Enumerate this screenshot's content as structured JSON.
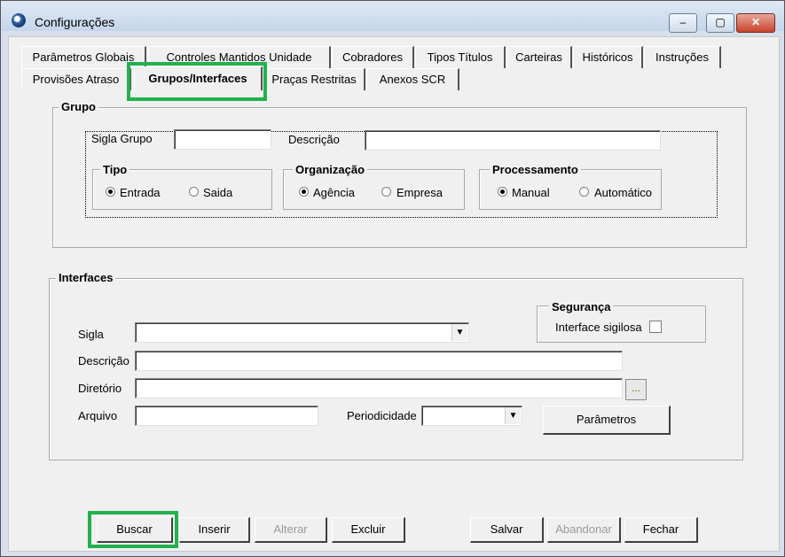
{
  "window": {
    "title": "Configurações",
    "min": "‒",
    "max": "▢",
    "close": "✕"
  },
  "tabs_row1": [
    "Parâmetros Globais",
    "Controles Mantidos Unidade",
    "Cobradores",
    "Tipos Títulos",
    "Carteiras",
    "Históricos",
    "Instruções"
  ],
  "tabs_row2": [
    "Provisões Atraso",
    "Grupos/Interfaces",
    "Praças Restritas",
    "Anexos SCR"
  ],
  "grupo": {
    "legend": "Grupo",
    "sigla_label": "Sigla Grupo",
    "sigla_value": "",
    "descricao_label": "Descrição",
    "descricao_value": "",
    "tipo": {
      "legend": "Tipo",
      "options": [
        "Entrada",
        "Saida"
      ],
      "selected": "Entrada"
    },
    "organizacao": {
      "legend": "Organização",
      "options": [
        "Agência",
        "Empresa"
      ],
      "selected": "Agência"
    },
    "processamento": {
      "legend": "Processamento",
      "options": [
        "Manual",
        "Automático"
      ],
      "selected": "Manual"
    }
  },
  "interfaces": {
    "legend": "Interfaces",
    "sigla_label": "Sigla",
    "descricao_label": "Descrição",
    "diretorio_label": "Diretório",
    "diretorio_button": "...",
    "arquivo_label": "Arquivo",
    "periodicidade_label": "Periodicidade",
    "parametros_button": "Parâmetros",
    "seguranca": {
      "legend": "Segurança",
      "checkbox_label": "Interface sigilosa",
      "checked": false
    }
  },
  "buttons": {
    "buscar": "Buscar",
    "inserir": "Inserir",
    "alterar": "Alterar",
    "excluir": "Excluir",
    "salvar": "Salvar",
    "abandonar": "Abandonar",
    "fechar": "Fechar"
  },
  "colors": {
    "highlight": "#22b14c",
    "window_bg": "#f0f0f0"
  }
}
